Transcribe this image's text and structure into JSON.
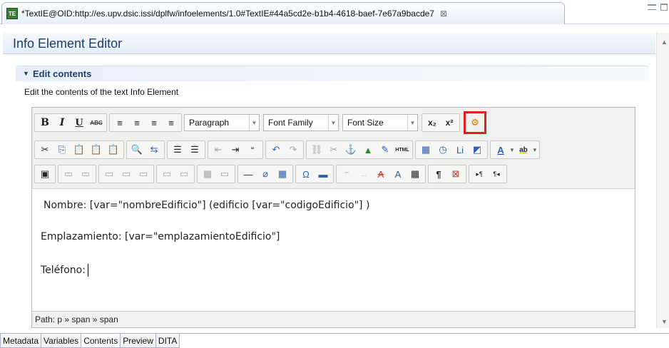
{
  "tab": {
    "icon_text": "TE",
    "title": "*TextIE@OID:http://es.upv.dsic.issi/dplfw/infoelements/1.0#TextIE#44a5cd2e-b1b4-4618-baef-7e67a9bacde7",
    "close": "⊠"
  },
  "form": {
    "title": "Info Element Editor"
  },
  "section": {
    "title": "Edit contents",
    "description": "Edit the contents of the text Info Element"
  },
  "toolbar": {
    "row1": {
      "format_buttons": [
        {
          "name": "bold",
          "glyph": "B"
        },
        {
          "name": "italic",
          "glyph": "I"
        },
        {
          "name": "underline",
          "glyph": "U"
        },
        {
          "name": "strikethrough",
          "glyph": "ABC"
        }
      ],
      "align_buttons": [
        "≡",
        "≡",
        "≡",
        "≡"
      ],
      "paragraph_select": "Paragraph",
      "font_family_select": "Font Family",
      "font_size_select": "Font Size",
      "subscript": "x₂",
      "superscript": "x²",
      "variable_button": "⚙"
    },
    "row2": [
      "✂",
      "⎘",
      "📋",
      "📋",
      "📋",
      "🔍",
      "⇆",
      "☰",
      "☰",
      "⇤",
      "⇥",
      "“",
      "↶",
      "↷",
      "⛓",
      "✂",
      "⚓",
      "▲",
      "✎",
      "HTML",
      "▦",
      "◷",
      "Li",
      "◩",
      "A",
      "ab"
    ],
    "row3": [
      "▣",
      "▭",
      "▭",
      "▭",
      "▭",
      "▭",
      "▭",
      "▭",
      "▦",
      "▭",
      "—",
      "⌀",
      "▦",
      "Ω",
      "▬",
      "“”",
      "...",
      "A",
      "A",
      "▦",
      "¶",
      "⊠",
      "▸¶",
      "¶◂"
    ]
  },
  "content": {
    "line1": "Nombre: [var=\"nombreEdificio\"] (edificio [var=\"codigoEdificio\"] )",
    "line2": "Emplazamiento: [var=\"emplazamientoEdificio\"]",
    "line3": "Teléfono:"
  },
  "pathbar": {
    "text": "Path: p » span » span"
  },
  "bottom_tabs": [
    "Metadata",
    "Variables",
    "Contents",
    "Preview",
    "DITA"
  ],
  "active_bottom_tab": "Contents",
  "colors": {
    "highlight": "#e02020",
    "title": "#1f3d6e"
  }
}
